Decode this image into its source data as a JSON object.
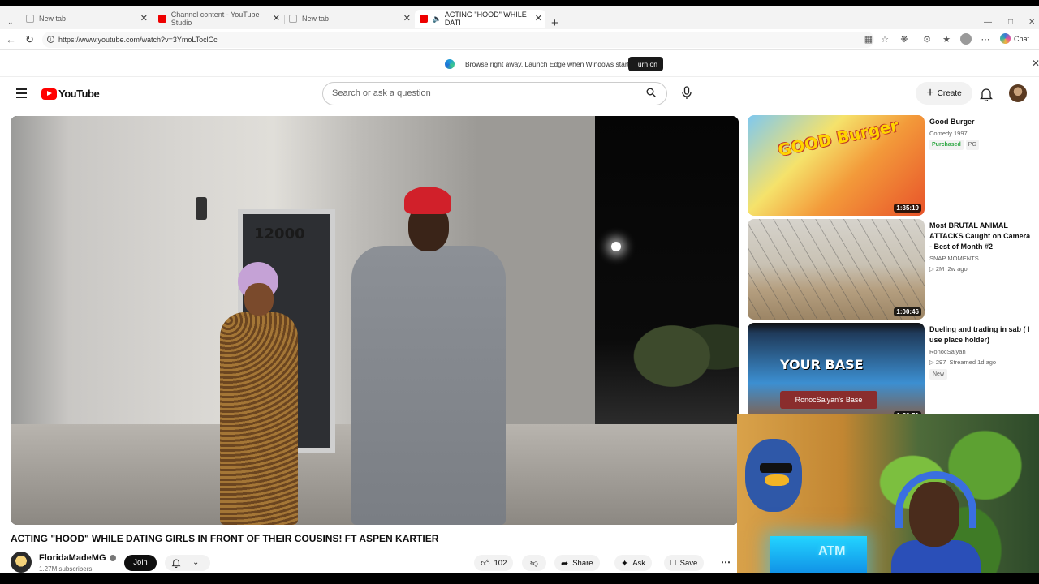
{
  "browser": {
    "tabs": [
      {
        "label": "New tab",
        "active": false
      },
      {
        "label": "Channel content - YouTube Studio",
        "active": false
      },
      {
        "label": "New tab",
        "active": false
      },
      {
        "label": "ACTING \"HOOD\" WHILE DATI",
        "active": true
      }
    ],
    "url": "https://www.youtube.com/watch?v=3YmoLToclCc",
    "chat_label": "Chat",
    "notification": {
      "message": "Browse right away. Launch Edge when Windows starts.",
      "button": "Turn on"
    }
  },
  "youtube": {
    "logo_text": "YouTube",
    "search_placeholder": "Search or ask a question",
    "create_label": "Create"
  },
  "video": {
    "title": "ACTING \"HOOD\" WHILE DATING GIRLS IN FRONT OF THEIR COUSINS! FT ASPEN KARTIER",
    "channel": "FloridaMadeMG",
    "subscribers": "1.27M subscribers",
    "join_label": "Join",
    "likes": "102",
    "share_label": "Share",
    "ask_label": "Ask",
    "save_label": "Save",
    "door_sign": "12000"
  },
  "recommendations": [
    {
      "title": "Good Burger",
      "meta1": "Comedy 1997",
      "badges": [
        "Purchased",
        "PG"
      ],
      "duration": "1:35:19",
      "thumb_text": "GOOD Burger"
    },
    {
      "title": "Most BRUTAL ANIMAL ATTACKS Caught on Camera - Best of Month #2",
      "channel": "SNAP MOMENTS",
      "views": "2M",
      "age": "2w ago",
      "duration": "1:00:46"
    },
    {
      "title": "Dueling and trading in sab ( I use place holder)",
      "channel": "RonocSaiyan",
      "views": "297",
      "age": "Streamed 1d ago",
      "badge": "New",
      "duration": "1:56:51",
      "thumb_text1": "YOUR BASE",
      "thumb_text2": "RonocSaiyan's Base"
    }
  ],
  "webcam": {
    "neon_text": "ATM"
  },
  "colors": {
    "youtube_red": "#ff0000",
    "purchased_green": "#2ba640"
  }
}
